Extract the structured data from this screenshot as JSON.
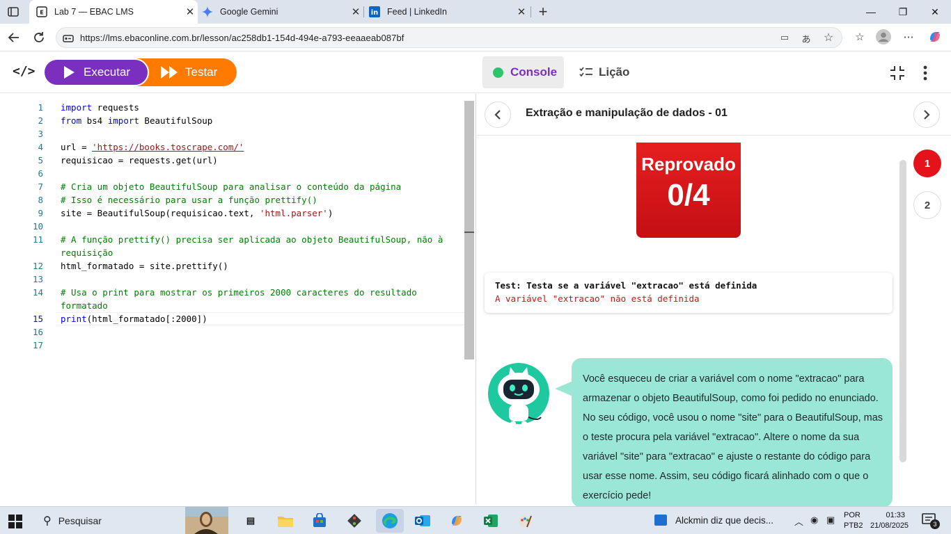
{
  "browser": {
    "tabs": [
      {
        "title": "Lab 7 — EBAC LMS",
        "active": true
      },
      {
        "title": "Google Gemini",
        "active": false
      },
      {
        "title": "Feed | LinkedIn",
        "active": false
      }
    ],
    "url": "https://lms.ebaconline.com.br/lesson/ac258db1-154d-494e-a793-eeaaeab087bf"
  },
  "toolbar": {
    "run_label": "Executar",
    "test_label": "Testar",
    "console_label": "Console",
    "lesson_label": "Lição"
  },
  "editor": {
    "line_numbers": [
      "1",
      "2",
      "3",
      "4",
      "5",
      "6",
      "7",
      "8",
      "9",
      "10",
      "11",
      "12",
      "13",
      "14",
      "15",
      "16",
      "17"
    ],
    "current_line": "15",
    "lines": {
      "l1_kw": "import",
      "l1_rest": " requests",
      "l2_kw1": "from",
      "l2_mid": " bs4 ",
      "l2_kw2": "import",
      "l2_rest": " BeautifulSoup",
      "l4_pre": "url = ",
      "l4_str": "'https://books.toscrape.com/'",
      "l5": "requisicao = requests.get(url)",
      "l7": "# Cria um objeto BeautifulSoup para analisar o conteúdo da página",
      "l8": "# Isso é necessário para usar a função prettify()",
      "l9_pre": "site = BeautifulSoup(requisicao.text, ",
      "l9_str": "'html.parser'",
      "l9_post": ")",
      "l11a": "# A função prettify() precisa ser aplicada ao objeto BeautifulSoup, não à",
      "l11b": "requisição",
      "l12": "html_formatado = site.prettify()",
      "l14a": "# Usa o print para mostrar os primeiros 2000 caracteres do resultado",
      "l14b": "formatado",
      "l15_kw": "print",
      "l15_rest": "(html_formatado[:2000])"
    }
  },
  "panel": {
    "title": "Extração e manipulação de dados - 01",
    "result_status": "Reprovado",
    "result_score": "0/4",
    "steps": [
      "1",
      "2"
    ],
    "test_title": "Test: Testa se a variável \"extracao\" está definida",
    "test_error": "A variável \"extracao\" não está definida",
    "feedback": "Você esqueceu de criar a variável com o nome \"extracao\" para armazenar o objeto BeautifulSoup, como foi pedido no enunciado. No seu código, você usou o nome \"site\" para o BeautifulSoup, mas o teste procura pela variável \"extracao\". Altere o nome da sua variável \"site\" para \"extracao\" e ajuste o restante do código para usar esse nome. Assim, seu código ficará alinhado com o que o exercício pede!"
  },
  "taskbar": {
    "search_placeholder": "Pesquisar",
    "news": "Alckmin diz que decis...",
    "lang1": "POR",
    "lang2": "PTB2",
    "time": "01:33",
    "date": "21/08/2025",
    "notifications": "3"
  },
  "colors": {
    "purple": "#7b2fbf",
    "orange": "#ff7a00",
    "fail_red": "#e4131b",
    "bubble": "#9be7d5",
    "console_dot": "#2ec46d"
  }
}
